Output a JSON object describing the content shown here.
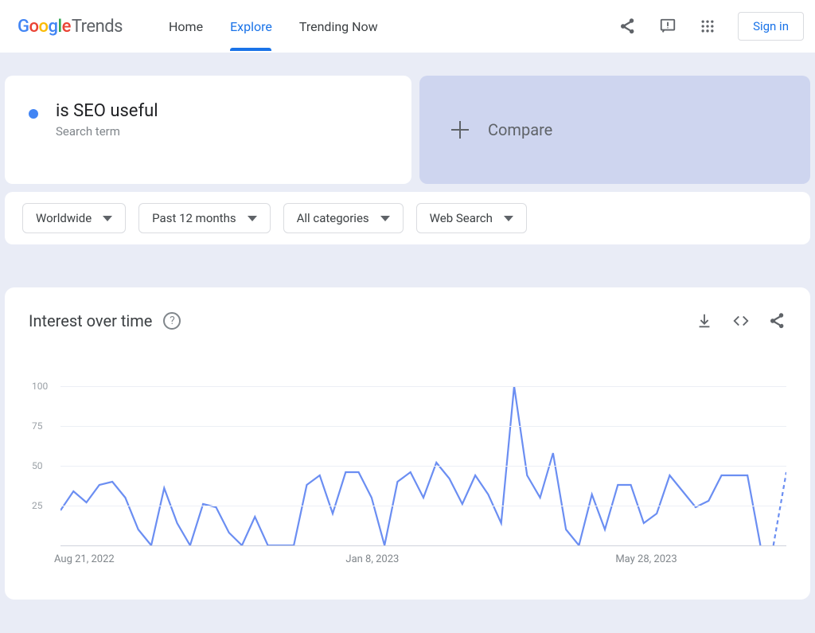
{
  "header": {
    "logo_google": "Google",
    "logo_trends": "Trends",
    "nav": [
      {
        "label": "Home",
        "active": false
      },
      {
        "label": "Explore",
        "active": true
      },
      {
        "label": "Trending Now",
        "active": false
      }
    ],
    "signin": "Sign in"
  },
  "search_term": {
    "title": "is SEO useful",
    "subtitle": "Search term",
    "dot_color": "#4285F4"
  },
  "compare": {
    "label": "Compare"
  },
  "filters": {
    "geo": "Worldwide",
    "timeframe": "Past 12 months",
    "category": "All categories",
    "type": "Web Search"
  },
  "chart_panel": {
    "title": "Interest over time"
  },
  "chart_data": {
    "type": "line",
    "title": "Interest over time",
    "ylabel": "",
    "xlabel": "",
    "ylim": [
      0,
      100
    ],
    "yticks": [
      25,
      50,
      75,
      100
    ],
    "x_tick_labels": [
      "Aug 21, 2022",
      "Jan 8, 2023",
      "May 28, 2023"
    ],
    "series": [
      {
        "name": "is SEO useful",
        "color": "#6b8ef2",
        "values": [
          22,
          34,
          27,
          38,
          40,
          30,
          10,
          0,
          36,
          14,
          0,
          26,
          24,
          8,
          0,
          18,
          0,
          0,
          0,
          38,
          44,
          20,
          46,
          46,
          30,
          0,
          40,
          46,
          30,
          52,
          42,
          26,
          44,
          32,
          14,
          100,
          44,
          30,
          58,
          10,
          0,
          32,
          10,
          38,
          38,
          14,
          20,
          44,
          34,
          24,
          28,
          44,
          44,
          44,
          0
        ],
        "projected_values": [
          0,
          46
        ]
      }
    ]
  }
}
